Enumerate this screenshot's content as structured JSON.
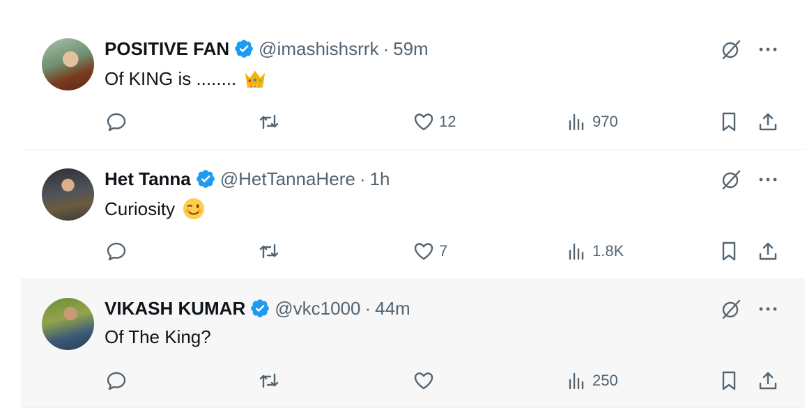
{
  "tweets": [
    {
      "name": "POSITIVE FAN",
      "handle": "@imashishsrrk",
      "separator": "·",
      "time": "59m",
      "text": "Of KING is ........",
      "emoji": "crown-emoji",
      "likes": "12",
      "views": "970",
      "retweets": "",
      "replies": ""
    },
    {
      "name": "Het Tanna",
      "handle": "@HetTannaHere",
      "separator": "·",
      "time": "1h",
      "text": "Curiosity",
      "emoji": "winking-face-emoji",
      "likes": "7",
      "views": "1.8K",
      "retweets": "",
      "replies": ""
    },
    {
      "name": "VIKASH KUMAR",
      "handle": "@vkc1000",
      "separator": "·",
      "time": "44m",
      "text": "Of The King?",
      "emoji": "",
      "likes": "",
      "views": "250",
      "retweets": "",
      "replies": ""
    }
  ],
  "colors": {
    "verified": "#1d9bf0",
    "text": "#0f1419",
    "muted": "#536471",
    "highlight_bg": "#f7f7f7"
  }
}
